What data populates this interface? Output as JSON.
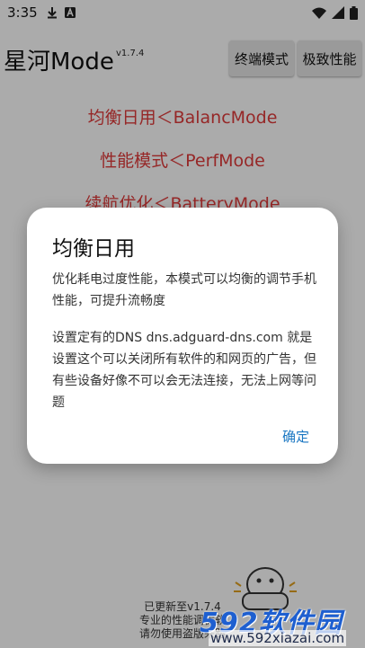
{
  "status_bar": {
    "time": "3:35",
    "icons": [
      "download-icon",
      "a-icon",
      "wifi-icon",
      "signal-icon",
      "battery-icon"
    ]
  },
  "header": {
    "title": "星河Mode",
    "version": "v1.7.4",
    "buttons": [
      "终端模式",
      "极致性能"
    ]
  },
  "modes": [
    "均衡日用＜BalancMode",
    "性能模式＜PerfMode",
    "续航优化＜BatteryMode"
  ],
  "footer": {
    "lines": [
      "已更新至v1.7.4",
      "专业的性能调优软",
      "请勿使用盗版来路"
    ]
  },
  "dialog": {
    "title": "均衡日用",
    "body1": "优化耗电过度性能，本模式可以均衡的调节手机性能，可提升流畅度",
    "body2": "设置定有的DNS dns.adguard-dns.com 就是设置这个可以关闭所有软件的和网页的广告，但有些设备好像不可以会无法连接，无法上网等问题",
    "ok_label": "确定"
  },
  "watermark": {
    "main": "592软件园",
    "url": "www.592xiazai.com"
  },
  "colors": {
    "mode_text": "#e03b3b",
    "dialog_button": "#1976c2",
    "watermark": "#1e5fd0"
  }
}
